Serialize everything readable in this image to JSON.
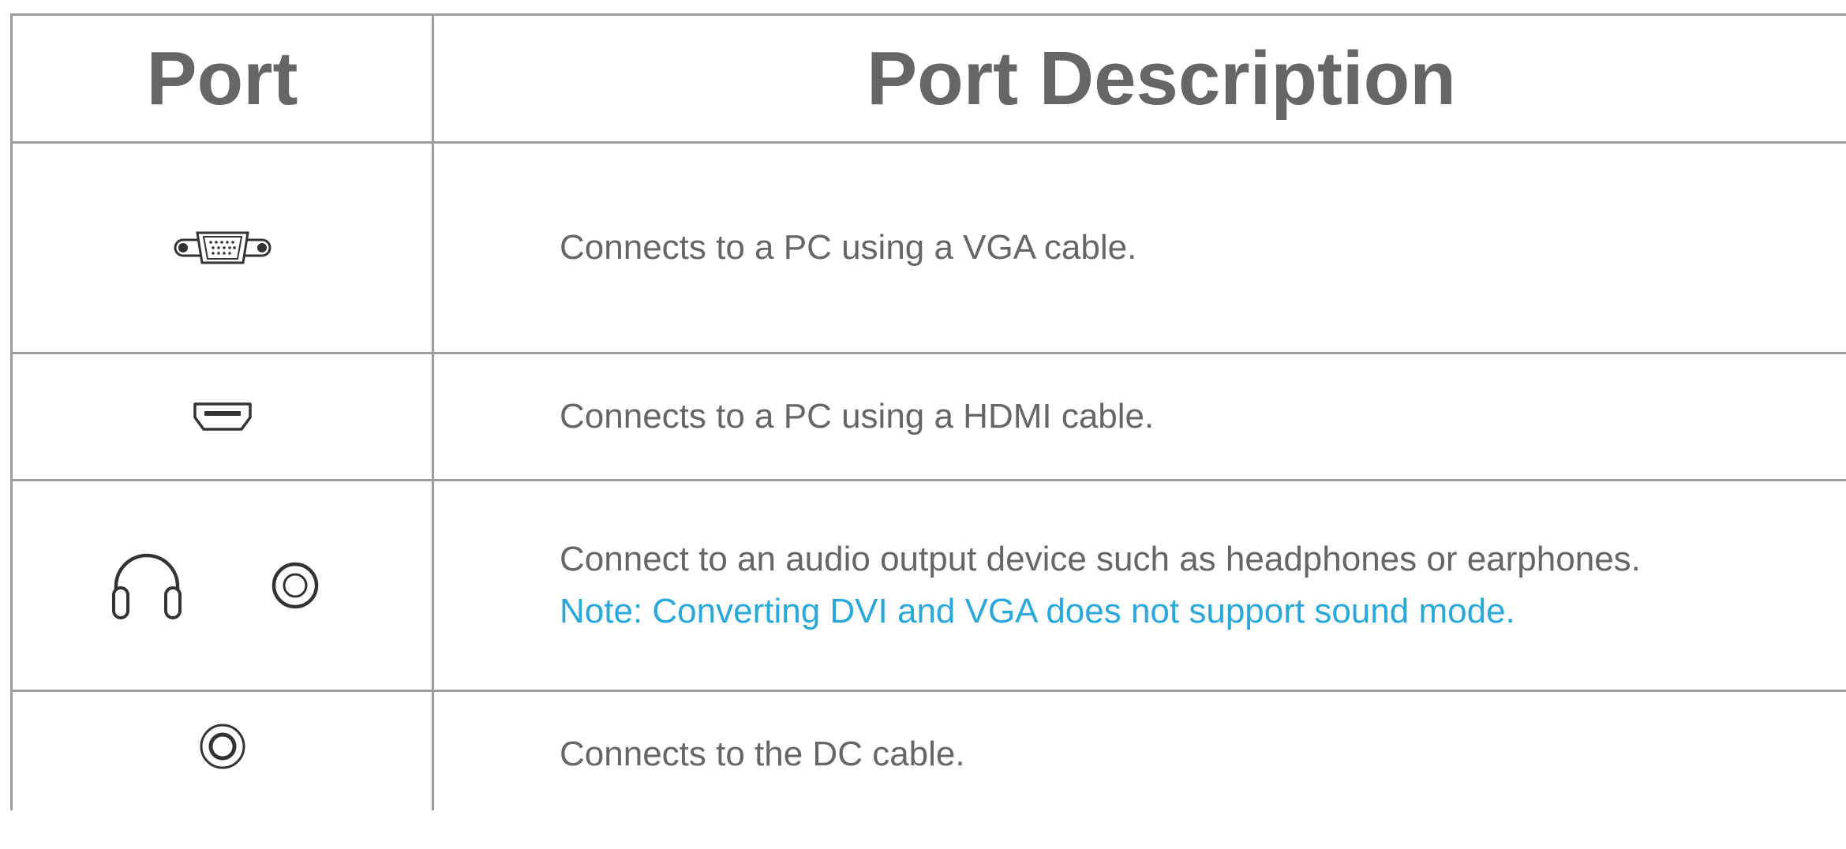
{
  "table": {
    "headers": {
      "port": "Port",
      "description": "Port Description"
    },
    "rows": [
      {
        "icon": "vga-port-icon",
        "description": "Connects to a PC using a VGA cable."
      },
      {
        "icon": "hdmi-port-icon",
        "description": "Connects to a PC using a HDMI cable."
      },
      {
        "icons": [
          "headphones-icon",
          "audio-jack-icon"
        ],
        "description": "Connect to an audio output device such as headphones or earphones.",
        "note": "Note: Converting DVI and VGA does not support sound mode."
      },
      {
        "icon": "dc-power-port-icon",
        "description": "Connects to the DC cable."
      }
    ]
  },
  "colors": {
    "text": "#666666",
    "border": "#9c9c9c",
    "note": "#29a8dc"
  }
}
